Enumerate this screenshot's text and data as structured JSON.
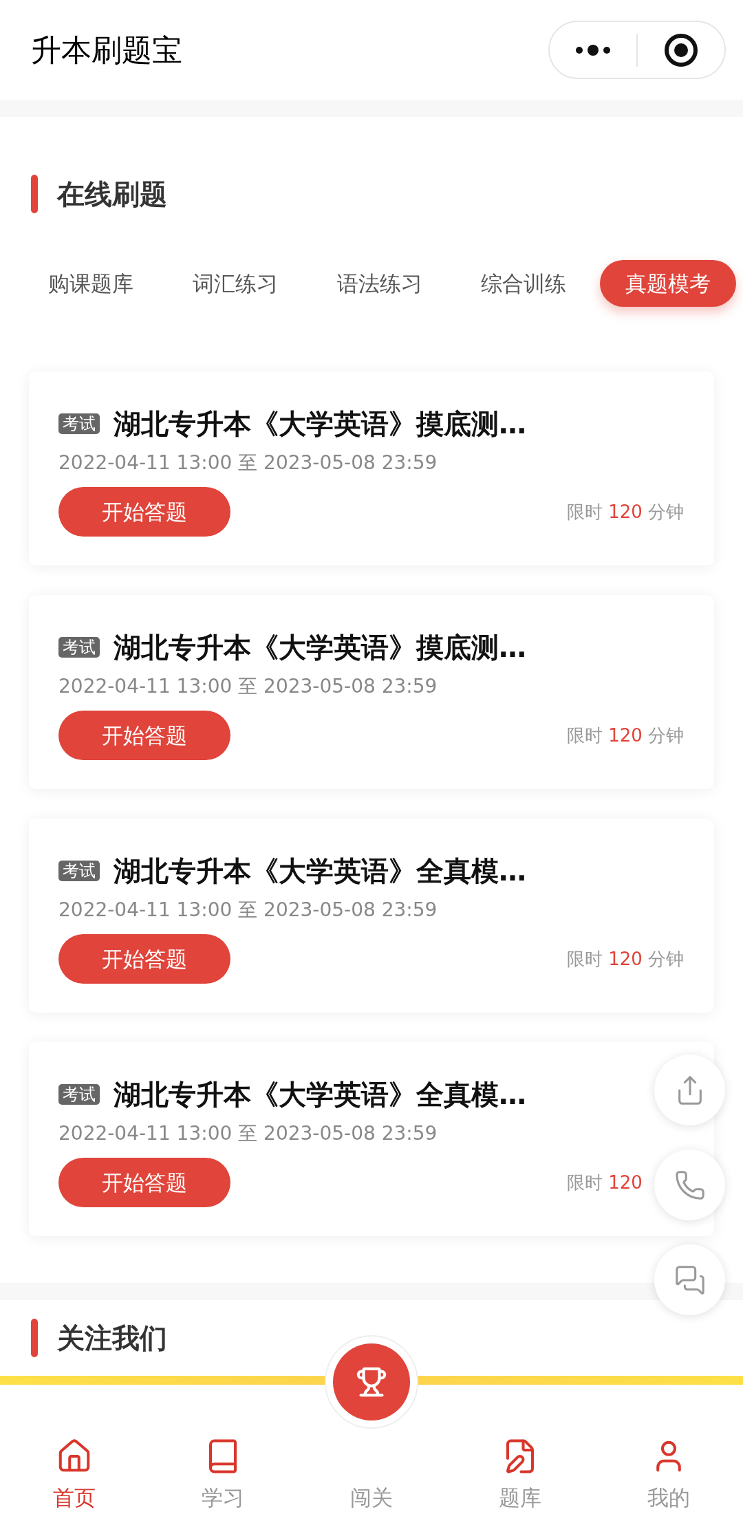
{
  "app_title": "升本刷题宝",
  "section_title": "在线刷题",
  "tabs": [
    {
      "label": "购课题库",
      "selected": false
    },
    {
      "label": "词汇练习",
      "selected": false
    },
    {
      "label": "语法练习",
      "selected": false
    },
    {
      "label": "综合训练",
      "selected": false
    },
    {
      "label": "真题模考",
      "selected": true
    }
  ],
  "exams": [
    {
      "tag": "考试",
      "title": "湖北专升本《大学英语》摸底测…",
      "time_range": "2022-04-11 13:00 至 2023-05-08 23:59",
      "button": "开始答题",
      "limit_prefix": "限时",
      "limit_value": "120",
      "limit_suffix": "分钟"
    },
    {
      "tag": "考试",
      "title": "湖北专升本《大学英语》摸底测…",
      "time_range": "2022-04-11 13:00 至 2023-05-08 23:59",
      "button": "开始答题",
      "limit_prefix": "限时",
      "limit_value": "120",
      "limit_suffix": "分钟"
    },
    {
      "tag": "考试",
      "title": "湖北专升本《大学英语》全真模…",
      "time_range": "2022-04-11 13:00 至 2023-05-08 23:59",
      "button": "开始答题",
      "limit_prefix": "限时",
      "limit_value": "120",
      "limit_suffix": "分钟"
    },
    {
      "tag": "考试",
      "title": "湖北专升本《大学英语》全真模…",
      "time_range": "2022-04-11 13:00 至 2023-05-08 23:59",
      "button": "开始答题",
      "limit_prefix": "限时",
      "limit_value": "120"
    }
  ],
  "follow_title": "关注我们",
  "nav": [
    {
      "label": "首页",
      "selected": true,
      "kind": "normal"
    },
    {
      "label": "学习",
      "selected": false,
      "kind": "normal"
    },
    {
      "label": "闯关",
      "selected": false,
      "kind": "raised"
    },
    {
      "label": "题库",
      "selected": false,
      "kind": "normal"
    },
    {
      "label": "我的",
      "selected": false,
      "kind": "normal"
    }
  ]
}
